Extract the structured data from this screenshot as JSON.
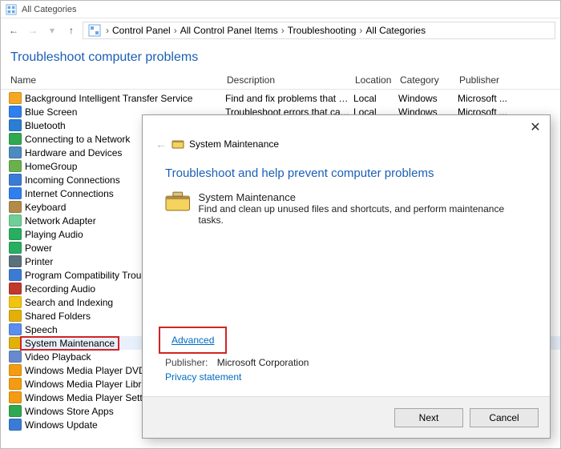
{
  "window": {
    "title": "All Categories"
  },
  "breadcrumbs": {
    "p0": "Control Panel",
    "p1": "All Control Panel Items",
    "p2": "Troubleshooting",
    "p3": "All Categories"
  },
  "heading": "Troubleshoot computer problems",
  "columns": {
    "name": "Name",
    "description": "Description",
    "location": "Location",
    "category": "Category",
    "publisher": "Publisher"
  },
  "items": [
    {
      "name": "Background Intelligent Transfer Service",
      "description": "Find and fix problems that may p...",
      "location": "Local",
      "category": "Windows",
      "publisher": "Microsoft ...",
      "ic": "#f5a623"
    },
    {
      "name": "Blue Screen",
      "description": "Troubleshoot errors that cause Wi...",
      "location": "Local",
      "category": "Windows",
      "publisher": "Microsoft ...",
      "ic": "#2f80ed"
    },
    {
      "name": "Bluetooth",
      "description": "",
      "location": "",
      "category": "",
      "publisher": "",
      "ic": "#2d7dd2"
    },
    {
      "name": "Connecting to a Network",
      "description": "",
      "location": "",
      "category": "",
      "publisher": "",
      "ic": "#2fa84f"
    },
    {
      "name": "Hardware and Devices",
      "description": "",
      "location": "",
      "category": "",
      "publisher": "",
      "ic": "#4b8bbe"
    },
    {
      "name": "HomeGroup",
      "description": "",
      "location": "",
      "category": "",
      "publisher": "",
      "ic": "#6ab04c"
    },
    {
      "name": "Incoming Connections",
      "description": "",
      "location": "",
      "category": "",
      "publisher": "",
      "ic": "#3a7bd5"
    },
    {
      "name": "Internet Connections",
      "description": "",
      "location": "",
      "category": "",
      "publisher": "",
      "ic": "#2f80ed"
    },
    {
      "name": "Keyboard",
      "description": "",
      "location": "",
      "category": "",
      "publisher": "",
      "ic": "#b28b49"
    },
    {
      "name": "Network Adapter",
      "description": "",
      "location": "",
      "category": "",
      "publisher": "",
      "ic": "#6fcf97"
    },
    {
      "name": "Playing Audio",
      "description": "",
      "location": "",
      "category": "",
      "publisher": "",
      "ic": "#27ae60"
    },
    {
      "name": "Power",
      "description": "",
      "location": "",
      "category": "",
      "publisher": "",
      "ic": "#27ae60"
    },
    {
      "name": "Printer",
      "description": "",
      "location": "",
      "category": "",
      "publisher": "",
      "ic": "#5c6f7c"
    },
    {
      "name": "Program Compatibility Troubleshooter",
      "description": "",
      "location": "",
      "category": "",
      "publisher": "",
      "ic": "#3a7bd5"
    },
    {
      "name": "Recording Audio",
      "description": "",
      "location": "",
      "category": "",
      "publisher": "",
      "ic": "#c0392b"
    },
    {
      "name": "Search and Indexing",
      "description": "",
      "location": "",
      "category": "",
      "publisher": "",
      "ic": "#f1c40f"
    },
    {
      "name": "Shared Folders",
      "description": "",
      "location": "",
      "category": "",
      "publisher": "",
      "ic": "#e2b007"
    },
    {
      "name": "Speech",
      "description": "",
      "location": "",
      "category": "",
      "publisher": "",
      "ic": "#5b8def"
    },
    {
      "name": "System Maintenance",
      "description": "",
      "location": "",
      "category": "",
      "publisher": "",
      "ic": "#e2b007",
      "selected": true
    },
    {
      "name": "Video Playback",
      "description": "",
      "location": "",
      "category": "",
      "publisher": "",
      "ic": "#6a89cc"
    },
    {
      "name": "Windows Media Player DVD",
      "description": "",
      "location": "",
      "category": "",
      "publisher": "",
      "ic": "#f39c12"
    },
    {
      "name": "Windows Media Player Library",
      "description": "",
      "location": "",
      "category": "",
      "publisher": "",
      "ic": "#f39c12"
    },
    {
      "name": "Windows Media Player Settings",
      "description": "",
      "location": "",
      "category": "",
      "publisher": "",
      "ic": "#f39c12"
    },
    {
      "name": "Windows Store Apps",
      "description": "",
      "location": "",
      "category": "",
      "publisher": "",
      "ic": "#2fa84f"
    },
    {
      "name": "Windows Update",
      "description": "",
      "location": "",
      "category": "",
      "publisher": "",
      "ic": "#3a7bd5"
    }
  ],
  "dialog": {
    "win_title": "System Maintenance",
    "heading": "Troubleshoot and help prevent computer problems",
    "item_title": "System Maintenance",
    "item_desc": "Find and clean up unused files and shortcuts, and perform maintenance tasks.",
    "advanced": "Advanced",
    "publisher_label": "Publisher:",
    "publisher_value": "Microsoft Corporation",
    "privacy": "Privacy statement",
    "next": "Next",
    "cancel": "Cancel"
  }
}
